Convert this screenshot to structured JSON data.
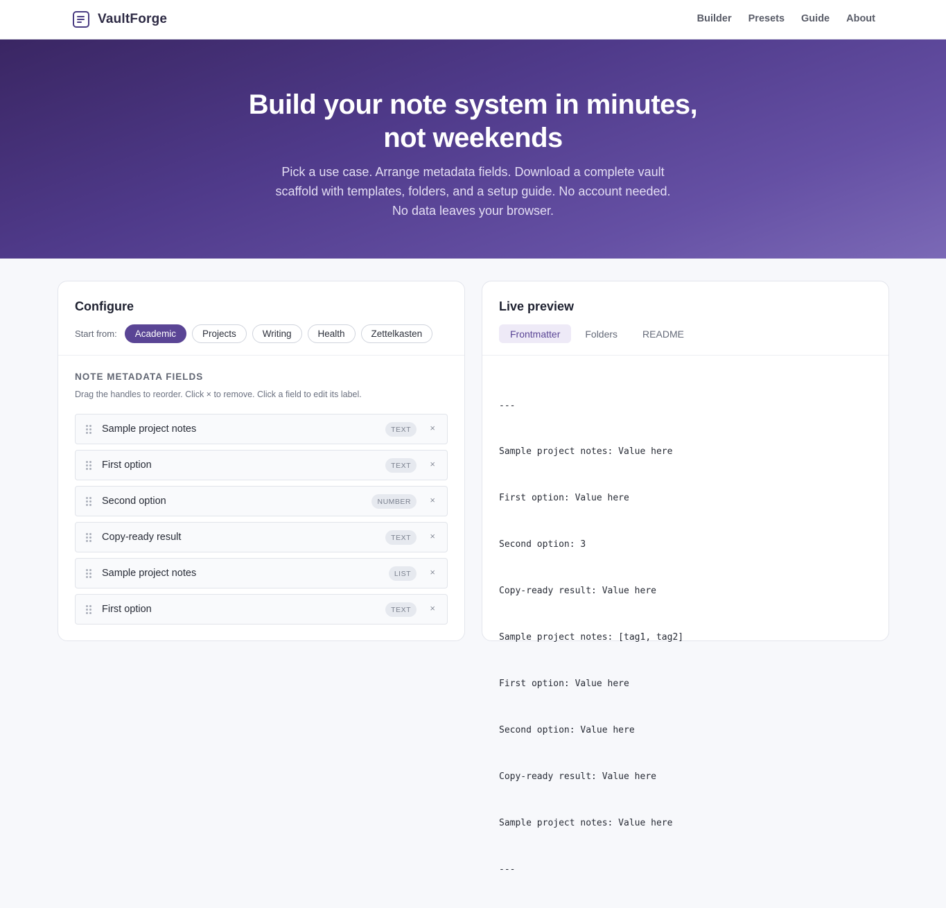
{
  "header": {
    "brand": "VaultForge",
    "nav": [
      "Builder",
      "Presets",
      "Guide",
      "About"
    ]
  },
  "hero": {
    "title_line1": "Build your note system in minutes,",
    "title_line2": "not weekends",
    "subtitle": "Pick a use case. Arrange metadata fields. Download a complete vault scaffold with templates, folders, and a setup guide. No account needed. No data leaves your browser."
  },
  "configure": {
    "title": "Configure",
    "start_label": "Start from:",
    "presets": [
      "Academic",
      "Projects",
      "Writing",
      "Health",
      "Zettelkasten"
    ],
    "active_preset": "Academic",
    "section_title": "NOTE METADATA FIELDS",
    "section_desc": "Drag the handles to reorder. Click × to remove. Click a field to edit its label.",
    "remove_glyph": "×",
    "fields": [
      {
        "label": "Sample project notes",
        "type": "TEXT"
      },
      {
        "label": "First option",
        "type": "TEXT"
      },
      {
        "label": "Second option",
        "type": "NUMBER"
      },
      {
        "label": "Copy-ready result",
        "type": "TEXT"
      },
      {
        "label": "Sample project notes",
        "type": "LIST"
      },
      {
        "label": "First option",
        "type": "TEXT"
      }
    ]
  },
  "preview": {
    "title": "Live preview",
    "tabs": [
      "Frontmatter",
      "Folders",
      "README"
    ],
    "active_tab": "Frontmatter",
    "code_lines": [
      "---",
      "Sample project notes: Value here",
      "First option: Value here",
      "Second option: 3",
      "Copy-ready result: Value here",
      "Sample project notes: [tag1, tag2]",
      "First option: Value here",
      "Second option: Value here",
      "Copy-ready result: Value here",
      "Sample project notes: Value here",
      "---"
    ]
  },
  "colors": {
    "accent": "#5a4595",
    "hero_start": "#3a2663",
    "hero_end": "#7b69b6"
  }
}
